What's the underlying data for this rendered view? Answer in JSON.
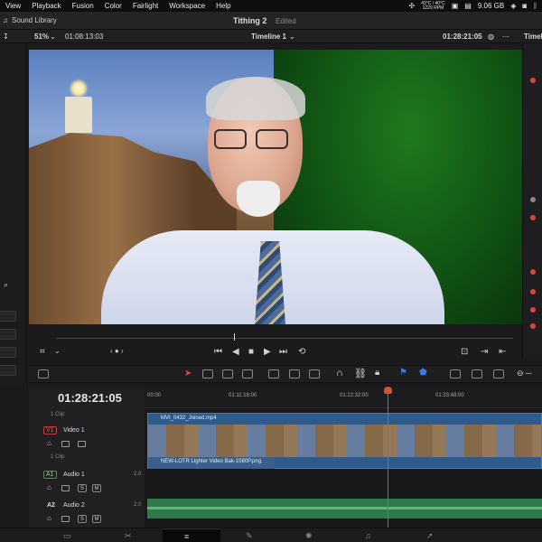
{
  "menubar": {
    "items": [
      "View",
      "Playback",
      "Fusion",
      "Color",
      "Fairlight",
      "Workspace",
      "Help"
    ],
    "temp": "43°C / 40°C",
    "rpm": "1229 RPM",
    "disk": "9.06 GB"
  },
  "titlebar": {
    "sound_library": "Sound Library",
    "project": "Tithing 2",
    "status": "Edited"
  },
  "viewer": {
    "zoom": "51%",
    "source_timecode": "01:08:13:03",
    "timeline_name": "Timeline 1",
    "record_timecode": "01:28:21:05",
    "right_label": "Timeli"
  },
  "timeline": {
    "timecode": "01:28:21:05",
    "ruler_ticks": [
      "00:00",
      "01:11:16:00",
      "01:22:32:00",
      "01:33:48:00"
    ],
    "tracks": {
      "v1": {
        "tag": "V1",
        "name": "Video 1",
        "clips": "1 Clip"
      },
      "a1": {
        "tag": "A1",
        "name": "Audio 1",
        "level": "2.0"
      },
      "a2": {
        "tag": "A2",
        "name": "Audio 2",
        "level": "2.0"
      },
      "top_clips": "1 Clip"
    },
    "clips": {
      "video_main": "MVI_0432_Joined.mp4",
      "video_sub": "NEW-LOTR Lighter Video Bak-1080P.png"
    },
    "buttons": {
      "solo": "S",
      "mute": "M"
    }
  },
  "colors": {
    "accent_red": "#e04a3a",
    "video_clip": "#2f5a8c",
    "audio_clip": "#2f7a4a"
  }
}
